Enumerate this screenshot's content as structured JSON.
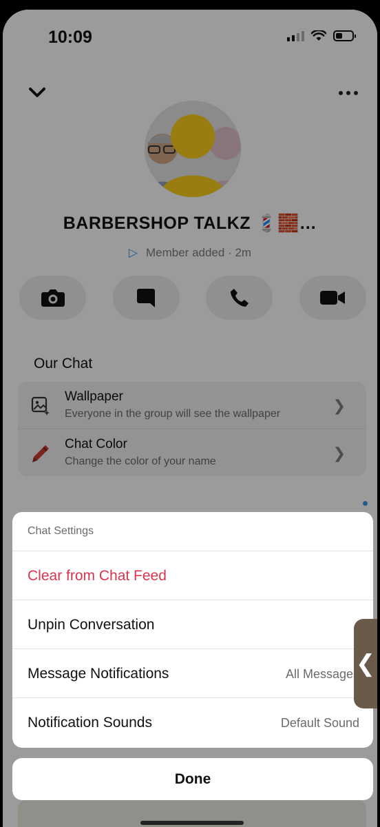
{
  "status": {
    "time": "10:09"
  },
  "header": {
    "group_name": "BARBERSHOP TALKZ 💈🧱…",
    "subtitle_arrow": "▷",
    "subtitle": "Member added · 2m"
  },
  "quick_actions": [
    {
      "name": "camera",
      "icon": "camera-icon"
    },
    {
      "name": "chat",
      "icon": "chat-bubble-icon"
    },
    {
      "name": "call",
      "icon": "phone-icon"
    },
    {
      "name": "video",
      "icon": "video-camera-icon"
    }
  ],
  "our_chat": {
    "title": "Our Chat",
    "items": [
      {
        "title": "Wallpaper",
        "subtitle": "Everyone in the group will see the wallpaper",
        "icon": "wallpaper-icon"
      },
      {
        "title": "Chat Color",
        "subtitle": "Change the color of your name",
        "icon": "crayon-icon"
      }
    ]
  },
  "chat_settings_sheet": {
    "title": "Chat Settings",
    "items": [
      {
        "label": "Clear from Chat Feed",
        "value": ""
      },
      {
        "label": "Unpin Conversation",
        "value": ""
      },
      {
        "label": "Message Notifications",
        "value": "All Messages"
      },
      {
        "label": "Notification Sounds",
        "value": "Default Sound"
      }
    ],
    "done_label": "Done"
  },
  "colors": {
    "danger": "#d9344e",
    "accent": "#3a8ee0"
  }
}
